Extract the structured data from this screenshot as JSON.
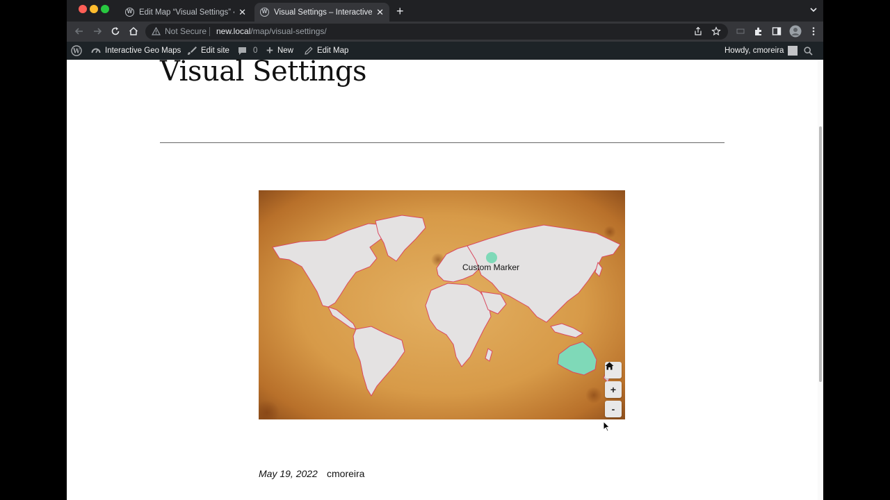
{
  "browser": {
    "tabs": [
      {
        "title": "Edit Map “Visual Settings” ‹ Interactive Geo Maps",
        "active": false
      },
      {
        "title": "Visual Settings – Interactive Geo Maps",
        "active": true
      }
    ],
    "security_label": "Not Secure",
    "url_host": "new.local",
    "url_path": "/map/visual-settings/"
  },
  "adminbar": {
    "site_name": "Interactive Geo Maps",
    "edit_site": "Edit site",
    "comments_count": "0",
    "new_label": "New",
    "edit_map": "Edit Map",
    "howdy": "Howdy, cmoreira"
  },
  "page": {
    "title": "Visual Settings",
    "date": "May 19, 2022",
    "author": "cmoreira"
  },
  "map": {
    "marker_label": "Custom Marker",
    "land_color": "#e4e2e2",
    "border_color": "#d9485f",
    "highlight_color": "#7fd9b8",
    "controls": {
      "home": "⌂",
      "zoom_in": "+",
      "zoom_out": "-"
    }
  }
}
